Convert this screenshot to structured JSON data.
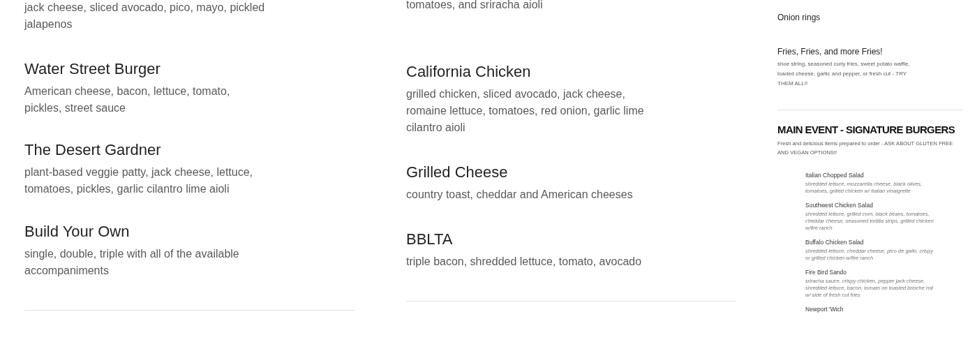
{
  "left_column": {
    "items": [
      {
        "description": "jack cheese, sliced avocado, pico, mayo, pickled jalapenos"
      },
      {
        "name": "Water Street Burger",
        "description": "American cheese, bacon, lettuce, tomato, pickles, street sauce"
      },
      {
        "name": "The Desert Gardner",
        "description": "plant-based veggie patty, jack cheese, lettuce, tomatoes, pickles, garlic cilantro lime aioli"
      },
      {
        "name": "Build Your Own",
        "description": "single, double, triple with all of the available accompaniments"
      }
    ]
  },
  "middle_column": {
    "items": [
      {
        "description": "tomatoes, and sriracha aioli"
      },
      {
        "name": "California Chicken",
        "description": "grilled chicken, sliced avocado, jack cheese, romaine lettuce, tomatoes, red onion, garlic lime cilantro aioli"
      },
      {
        "name": "Grilled Cheese",
        "description": "country toast, cheddar and American cheeses"
      },
      {
        "name": "BBLTA",
        "description": "triple bacon, shredded lettuce, tomato, avocado"
      }
    ]
  },
  "right_column": {
    "items": [
      {
        "name": "Onion rings"
      },
      {
        "name": "Fries, Fries, and more Fries!",
        "description": "shoe string, seasoned curly fries, sweet potato waffle, loaded cheese, garlic and pepper, or fresh cut - TRY THEM ALL!!"
      }
    ],
    "section": {
      "title": "MAIN EVENT - SIGNATURE BURGERS",
      "description": "Fresh and delicious items prepared to order - ASK ABOUT GLUTEN FREE AND VEGAN OPTIONS!!"
    },
    "inset_items": [
      {
        "name": "Italian Chopped Salad",
        "description": "shredded lettuce, mozzarella cheese, black olives, tomatoes, grilled chicken w/ Italian vinaigrette"
      },
      {
        "name": "Southwest Chicken Salad",
        "description": "shredded lettuce, grilled corn, black beans, tomatoes, cheddar cheese, seasoned tortilla strips, grilled chicken w/fire ranch"
      },
      {
        "name": "Buffalo Chicken Salad",
        "description": "shredded lettuce, cheddar cheese, pico de gallo, crispy or grilled chicken w/fire ranch"
      },
      {
        "name": "Fire Bird Sando",
        "description": "sriracha sauce, crispy chicken, pepper jack cheese, shredded lettuce, bacon, tomato on toasted brioche roll w/ side of fresh cut fries"
      },
      {
        "name": "Newport 'Wich"
      }
    ]
  }
}
